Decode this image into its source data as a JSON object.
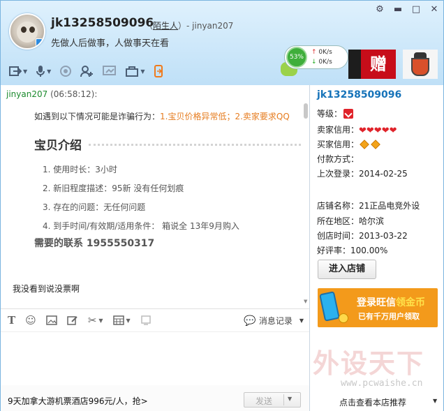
{
  "header": {
    "username": "jk13258509096",
    "relation_open": "（",
    "relation_link": "陌生人",
    "relation_close": "）- jinyan207",
    "signature": "先做人后做事，人做事天在看",
    "speed": {
      "percent": "53%",
      "up": "0K/s",
      "down": "0K/s"
    },
    "ad_text": "赠"
  },
  "chat": {
    "sender": "jinyan207",
    "time": "(06:58:12):",
    "warning_prefix": "如遇到以下情况可能是诈骗行为：",
    "warning_items": "1.宝贝价格异常低；2.卖家要求QQ",
    "section_title": "宝贝介绍",
    "items": [
      "1. 使用时长：3小时",
      "2. 新旧程度描述：95新 没有任何划痕",
      "3. 存在的问题：无任何问题",
      "4. 到手时间/有效期/适用条件： 箱说全 13年9月购入"
    ],
    "contact": "需要的联系 1955550317",
    "my_message": "我没看到说没票啊",
    "history_label": "消息记录",
    "promo": "9天加拿大游机票酒店996元/人，抢>",
    "send_label": "发送"
  },
  "sidebar": {
    "name": "jk13258509096",
    "level_label": "等级：",
    "seller_label": "卖家信用：",
    "seller_hearts": "❤❤❤❤❤",
    "buyer_label": "买家信用：",
    "pay_label": "付款方式：",
    "last_login": "上次登录：2014-02-25",
    "shop_name": "店铺名称：21正品电竞外设",
    "region": "所在地区：哈尔滨",
    "created": "创店时间：2013-03-22",
    "rating": "好评率：100.00%",
    "shop_button": "进入店铺",
    "banner_line1_a": "登录旺信",
    "banner_line1_b": "领金币",
    "banner_line2": "已有千万用户领取",
    "watermark": "外设天下",
    "watermark_url": "www.pcwaishe.cn",
    "recommend": "点击查看本店推荐"
  },
  "colors": {
    "accent": "#1673b9",
    "warning": "#e67c1f",
    "sender": "#1b8a2d",
    "heart": "#e0232a"
  }
}
